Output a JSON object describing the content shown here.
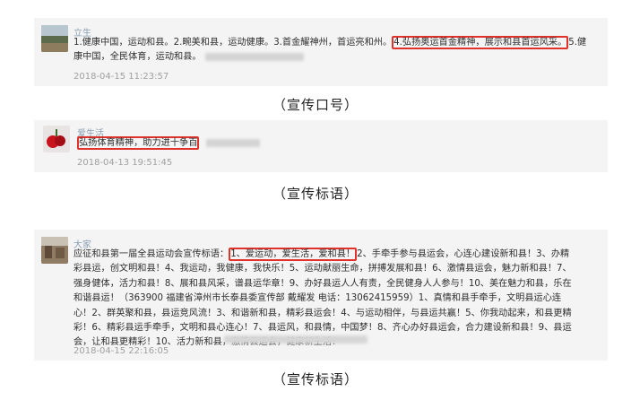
{
  "posts": [
    {
      "username": "立生",
      "text_before": "1.健康中国，运动和县。2.畹美和县，运动健康。3.首金耀神州，首运亮和州。",
      "highlight": "4.弘扬奥运首金精神，展示和县首运风采。",
      "text_after": "5.健康中国，全民体育，运动和县。",
      "timestamp": "2018-04-15 11:23:57"
    },
    {
      "username": "爱生活",
      "highlight": "弘扬体育精神，助力进十争百",
      "timestamp": "2018-04-13 19:51:45"
    },
    {
      "username": "大家",
      "text_before": "应征和县第一届全县运动会宣传标语：",
      "highlight": "1、爱运动，爱生活，爱和县！",
      "text_after": "2、手牵手参与县运会，心连心建设新和县！3、办精彩县运，创文明和县！4、我运动，我健康，我快乐！5、运动献丽生命，拼搏发展和县！6、激情县运会，魅力新和县！7、强身健体，活力和县！8、展和县风采，谱县运华章！9、办好县运人人有责，全民健身人人参与！10、美在魅力和县，乐在和谐县运！（363900 福建省漳州市长泰县委宣传部 戴耀发 电话：13062415959）1、真情和县手牵手，文明县运心连心！2、群英聚和县，县运竞风流！3、和谐新和县，精彩县运会！4、与运动相伴，与县运共赢！5、你我动起来，和县更精彩！6、精彩县运手牵手，文明和县心连心！7、县运风，和县情，中国梦！8、齐心办好县运会，合力建设新和县！9、县运会，让和县更精彩！10、活力新和县，激情县运会，健康新生活！",
      "timestamp": "2018-04-15 22:16:05"
    }
  ],
  "captions": [
    "（宣传口号）",
    "（宣传标语）",
    "（宣传标语）"
  ],
  "colors": {
    "highlight_box": "#e0322b",
    "panel_bg": "#f4f4f4",
    "username": "#8aa0b4"
  }
}
